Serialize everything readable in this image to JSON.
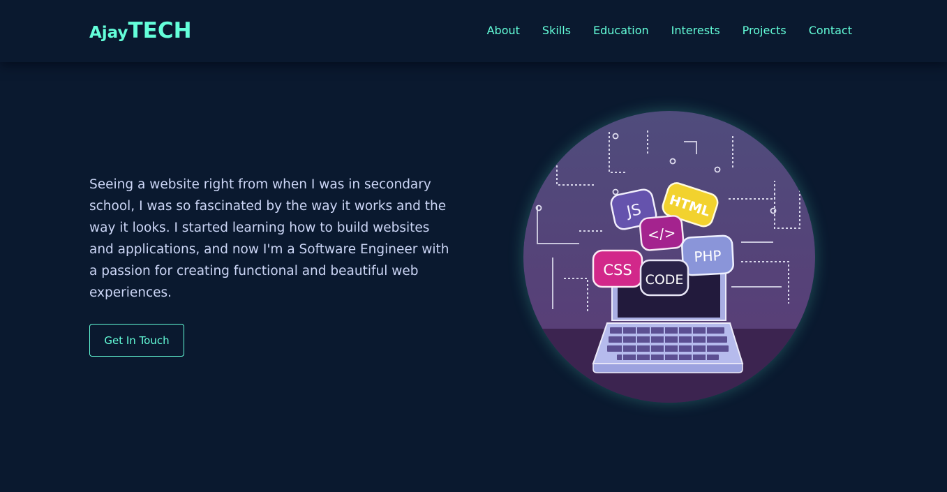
{
  "brand": {
    "prefix": "Ajay",
    "suffix": "TECH"
  },
  "nav": {
    "links": [
      "About",
      "Skills",
      "Education",
      "Interests",
      "Projects",
      "Contact"
    ]
  },
  "hero": {
    "description": "Seeing a website right from when I was in secondary school, I was so fascinated by the way it works and the way it looks. I started learning how to build websites and applications, and now I'm a Software Engineer with a passion for creating functional and beautiful web experiences.",
    "cta_label": "Get In Touch",
    "illustration": {
      "badges": [
        "JS",
        "HTML",
        "</>",
        "PHP",
        "CSS",
        "CODE"
      ]
    }
  },
  "colors": {
    "background": "#0a192f",
    "accent": "#64ffda",
    "text": "#ccd6f6"
  }
}
